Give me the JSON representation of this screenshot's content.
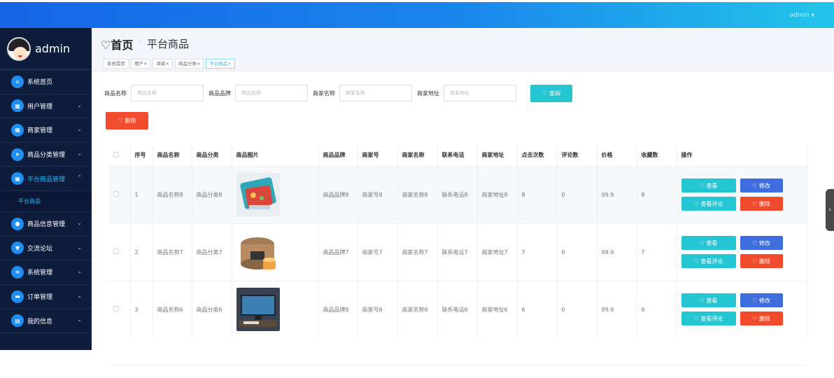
{
  "header": {
    "user": "admin ▾"
  },
  "sidebar": {
    "brand": "admin",
    "items": [
      {
        "label": "系统首页",
        "icon": "home-icon",
        "glyph": "⌂",
        "arrow": ""
      },
      {
        "label": "用户管理",
        "icon": "grid-icon",
        "glyph": "▦",
        "arrow": "⌄"
      },
      {
        "label": "商家管理",
        "icon": "grid-icon",
        "glyph": "▦",
        "arrow": "⌄"
      },
      {
        "label": "商品分类管理",
        "icon": "send-icon",
        "glyph": "➤",
        "arrow": "⌄"
      },
      {
        "label": "平台商品管理",
        "icon": "apps-icon",
        "glyph": "▦",
        "arrow": "⌃"
      },
      {
        "label": "商品信息管理",
        "icon": "person-icon",
        "glyph": "●",
        "arrow": "⌄"
      },
      {
        "label": "交流论坛",
        "icon": "trophy-icon",
        "glyph": "▼",
        "arrow": "⌄"
      },
      {
        "label": "系统管理",
        "icon": "list-icon",
        "glyph": "≡",
        "arrow": "⌄"
      },
      {
        "label": "订单管理",
        "icon": "ticket-icon",
        "glyph": "▬",
        "arrow": "⌄"
      },
      {
        "label": "我的信息",
        "icon": "card-icon",
        "glyph": "▤",
        "arrow": "⌄"
      }
    ],
    "sub_item": "平台商品"
  },
  "breadcrumb": {
    "home": "♡首页",
    "sep": "⁝",
    "current": "平台商品"
  },
  "tabs": [
    "系统首页",
    "用户×",
    "商家×",
    "商品分类×",
    "平台商品×"
  ],
  "search": {
    "fields": [
      {
        "label": "商品名称",
        "placeholder": "商品名称"
      },
      {
        "label": "商品品牌",
        "placeholder": "商品品牌"
      },
      {
        "label": "商家名称",
        "placeholder": "商家名称"
      },
      {
        "label": "商家地址",
        "placeholder": "商家地址"
      }
    ],
    "query_label": "♡ 查询",
    "delete_label": "♡ 删除"
  },
  "table": {
    "headers": [
      "",
      "序号",
      "商品名称",
      "商品分类",
      "商品图片",
      "商品品牌",
      "商家号",
      "商家名称",
      "联系电话",
      "商家地址",
      "点击次数",
      "评论数",
      "价格",
      "收藏数",
      "操作"
    ],
    "rows": [
      {
        "idx": "1",
        "name": "商品名称8",
        "cat": "商品分类8",
        "img": "bag-image",
        "brand": "商品品牌8",
        "mid": "商家号8",
        "mname": "商家名称8",
        "phone": "联系电话8",
        "addr": "商家地址8",
        "clicks": "8",
        "comments": "0",
        "price": "99.9",
        "favs": "8"
      },
      {
        "idx": "2",
        "name": "商品名称7",
        "cat": "商品分类7",
        "img": "cooker-image",
        "brand": "商品品牌7",
        "mid": "商家号7",
        "mname": "商家名称7",
        "phone": "联系电话7",
        "addr": "商家地址7",
        "clicks": "7",
        "comments": "0",
        "price": "99.9",
        "favs": "7"
      },
      {
        "idx": "3",
        "name": "商品名称6",
        "cat": "商品分类6",
        "img": "monitor-image",
        "brand": "商品品牌6",
        "mid": "商家号6",
        "mname": "商家名称6",
        "phone": "联系电话6",
        "addr": "商家地址6",
        "clicks": "6",
        "comments": "0",
        "price": "99.9",
        "favs": "6"
      }
    ],
    "ops": {
      "view": "♡ 查看",
      "edit": "♡ 修改",
      "comment": "♡ 查看评论",
      "delete": "♡ 删除"
    }
  },
  "colors": {
    "accent": "#25c6d3",
    "danger": "#f04b2d",
    "primary": "#3f6dde",
    "sidebar": "#0f1d3d"
  }
}
